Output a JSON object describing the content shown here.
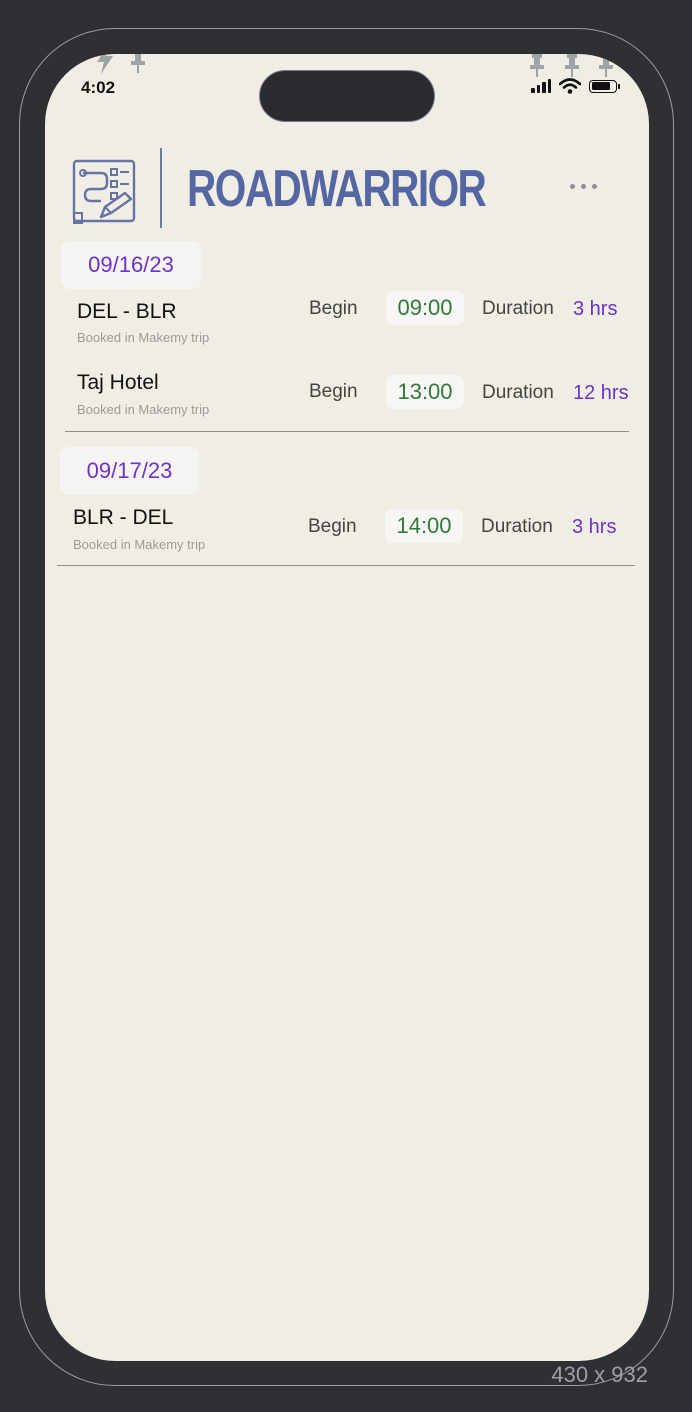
{
  "status_bar": {
    "time": "4:02"
  },
  "header": {
    "brand": "ROADWARRIOR",
    "logo_icon": "route-map-icon",
    "menu_icon": "more-horizontal-icon"
  },
  "labels": {
    "begin": "Begin",
    "duration": "Duration"
  },
  "days": [
    {
      "date": "09/16/23",
      "items": [
        {
          "title": "DEL - BLR",
          "subtitle": "Booked in Makemy trip",
          "begin": "09:00",
          "duration": "3 hrs"
        },
        {
          "title": "Taj Hotel",
          "subtitle": "Booked in Makemy trip",
          "begin": "13:00",
          "duration": "12 hrs"
        }
      ]
    },
    {
      "date": "09/17/23",
      "items": [
        {
          "title": "BLR - DEL",
          "subtitle": "Booked in Makemy trip",
          "begin": "14:00",
          "duration": "3 hrs"
        }
      ]
    }
  ],
  "frame_label": "430 x 932",
  "colors": {
    "background": "#f0eee4",
    "accent": "#6d33c9",
    "time_text": "#2e7a3c",
    "brand": "#5567a3"
  }
}
